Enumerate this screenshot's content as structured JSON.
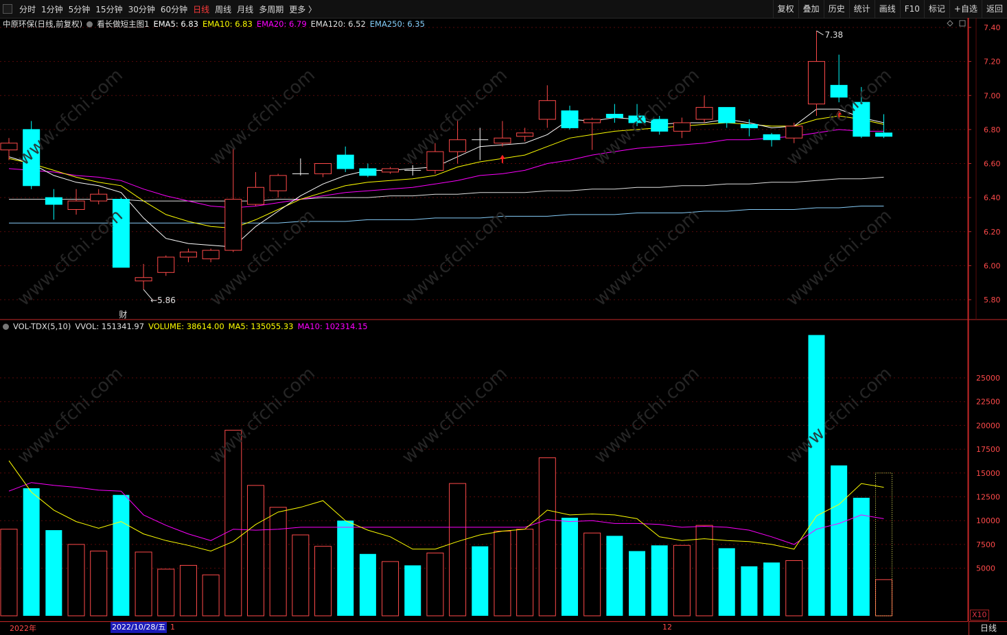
{
  "toolbar": {
    "periods": [
      "分时",
      "1分钟",
      "5分钟",
      "15分钟",
      "30分钟",
      "60分钟",
      "日线",
      "周线",
      "月线",
      "多周期",
      "更多 〉"
    ],
    "active_period": "日线",
    "right_buttons": [
      "复权",
      "叠加",
      "历史",
      "统计",
      "画线",
      "F10",
      "标记",
      "+自选",
      "返回"
    ]
  },
  "main_info": {
    "title": "中原环保(日线,前复权)",
    "indicator_name": "看长做短主图1",
    "ema5": "EMA5: 6.83",
    "ema10": "EMA10: 6.83",
    "ema20": "EMA20: 6.79",
    "ema120": "EMA120: 6.52",
    "ema250": "EMA250: 6.35"
  },
  "vol_info": {
    "name": "VOL-TDX(5,10)",
    "vvol": "VVOL: 151341.97",
    "volume": "VOLUME: 38614.00",
    "ma5": "MA5: 135055.33",
    "ma10": "MA10: 102314.15"
  },
  "price_axis": [
    "7.40",
    "7.20",
    "7.00",
    "6.80",
    "6.60",
    "6.40",
    "6.20",
    "6.00",
    "5.80"
  ],
  "vol_axis": [
    "25000",
    "22500",
    "20000",
    "17500",
    "15000",
    "12500",
    "10000",
    "7500",
    "5000"
  ],
  "annotations": {
    "high_label": "7.38",
    "low_label": "5.86",
    "fin_marker": "财"
  },
  "bottom": {
    "year_label": "2022年",
    "selected_date": "2022/10/28/五",
    "selected_suffix": "1",
    "month_label": "12",
    "corner_label": "日线",
    "x10": "X10"
  },
  "colors": {
    "up": "#ff4a4a",
    "down": "#00ffff",
    "ema5": "#ffffff",
    "ema10": "#ffff00",
    "ema20": "#ff00ff",
    "ema120": "#9370db",
    "ema250": "#87cefa",
    "bg": "#000000",
    "grid": "#5a0a0a"
  },
  "chart_data": [
    {
      "type": "candlestick",
      "title": "中原环保(日线,前复权)",
      "ylim": [
        5.7,
        7.45
      ],
      "candles": [
        {
          "o": 6.68,
          "h": 6.75,
          "l": 6.62,
          "c": 6.72
        },
        {
          "o": 6.8,
          "h": 6.85,
          "l": 6.45,
          "c": 6.47
        },
        {
          "o": 6.4,
          "h": 6.45,
          "l": 6.27,
          "c": 6.36
        },
        {
          "o": 6.33,
          "h": 6.45,
          "l": 6.3,
          "c": 6.38
        },
        {
          "o": 6.38,
          "h": 6.45,
          "l": 6.36,
          "c": 6.42
        },
        {
          "o": 6.39,
          "h": 6.4,
          "l": 5.99,
          "c": 5.99
        },
        {
          "o": 5.91,
          "h": 6.01,
          "l": 5.86,
          "c": 5.93
        },
        {
          "o": 5.96,
          "h": 6.06,
          "l": 5.94,
          "c": 6.05
        },
        {
          "o": 6.05,
          "h": 6.1,
          "l": 6.02,
          "c": 6.08
        },
        {
          "o": 6.04,
          "h": 6.1,
          "l": 6.02,
          "c": 6.09
        },
        {
          "o": 6.09,
          "h": 6.69,
          "l": 6.08,
          "c": 6.39
        },
        {
          "o": 6.36,
          "h": 6.55,
          "l": 6.35,
          "c": 6.46
        },
        {
          "o": 6.44,
          "h": 6.54,
          "l": 6.4,
          "c": 6.53
        },
        {
          "o": 6.54,
          "h": 6.63,
          "l": 6.53,
          "c": 6.54
        },
        {
          "o": 6.54,
          "h": 6.6,
          "l": 6.52,
          "c": 6.6
        },
        {
          "o": 6.65,
          "h": 6.7,
          "l": 6.55,
          "c": 6.57
        },
        {
          "o": 6.57,
          "h": 6.6,
          "l": 6.52,
          "c": 6.53
        },
        {
          "o": 6.55,
          "h": 6.58,
          "l": 6.54,
          "c": 6.57
        },
        {
          "o": 6.56,
          "h": 6.59,
          "l": 6.53,
          "c": 6.56
        },
        {
          "o": 6.56,
          "h": 6.72,
          "l": 6.54,
          "c": 6.67
        },
        {
          "o": 6.67,
          "h": 6.86,
          "l": 6.6,
          "c": 6.74
        },
        {
          "o": 6.74,
          "h": 6.81,
          "l": 6.62,
          "c": 6.74
        },
        {
          "o": 6.72,
          "h": 6.85,
          "l": 6.7,
          "c": 6.75
        },
        {
          "o": 6.76,
          "h": 6.81,
          "l": 6.73,
          "c": 6.78
        },
        {
          "o": 6.86,
          "h": 7.06,
          "l": 6.81,
          "c": 6.97
        },
        {
          "o": 6.91,
          "h": 6.94,
          "l": 6.8,
          "c": 6.81
        },
        {
          "o": 6.84,
          "h": 6.87,
          "l": 6.68,
          "c": 6.86
        },
        {
          "o": 6.89,
          "h": 6.95,
          "l": 6.84,
          "c": 6.87
        },
        {
          "o": 6.88,
          "h": 6.95,
          "l": 6.82,
          "c": 6.84
        },
        {
          "o": 6.86,
          "h": 6.88,
          "l": 6.77,
          "c": 6.79
        },
        {
          "o": 6.79,
          "h": 6.87,
          "l": 6.75,
          "c": 6.84
        },
        {
          "o": 6.86,
          "h": 7.0,
          "l": 6.84,
          "c": 6.93
        },
        {
          "o": 6.93,
          "h": 6.93,
          "l": 6.81,
          "c": 6.84
        },
        {
          "o": 6.83,
          "h": 6.86,
          "l": 6.76,
          "c": 6.81
        },
        {
          "o": 6.77,
          "h": 6.78,
          "l": 6.7,
          "c": 6.74
        },
        {
          "o": 6.75,
          "h": 6.84,
          "l": 6.72,
          "c": 6.82
        },
        {
          "o": 6.95,
          "h": 7.38,
          "l": 6.88,
          "c": 7.2
        },
        {
          "o": 7.06,
          "h": 7.24,
          "l": 6.96,
          "c": 6.99
        },
        {
          "o": 6.96,
          "h": 7.05,
          "l": 6.75,
          "c": 6.76
        },
        {
          "o": 6.78,
          "h": 6.89,
          "l": 6.75,
          "c": 6.76
        }
      ],
      "ema5": [
        6.64,
        6.6,
        6.53,
        6.49,
        6.47,
        6.43,
        6.28,
        6.16,
        6.13,
        6.12,
        6.11,
        6.23,
        6.32,
        6.41,
        6.48,
        6.53,
        6.56,
        6.56,
        6.57,
        6.58,
        6.64,
        6.7,
        6.71,
        6.72,
        6.77,
        6.86,
        6.85,
        6.87,
        6.86,
        6.83,
        6.84,
        6.84,
        6.86,
        6.84,
        6.81,
        6.82,
        6.92,
        6.92,
        6.87,
        6.84
      ],
      "ema10": [
        6.63,
        6.6,
        6.56,
        6.52,
        6.49,
        6.47,
        6.38,
        6.3,
        6.26,
        6.23,
        6.22,
        6.27,
        6.33,
        6.39,
        6.43,
        6.47,
        6.49,
        6.5,
        6.51,
        6.53,
        6.58,
        6.61,
        6.63,
        6.65,
        6.7,
        6.75,
        6.77,
        6.79,
        6.8,
        6.81,
        6.82,
        6.83,
        6.84,
        6.83,
        6.82,
        6.82,
        6.86,
        6.88,
        6.86,
        6.83
      ],
      "ema20": [
        6.57,
        6.56,
        6.55,
        6.53,
        6.52,
        6.5,
        6.45,
        6.41,
        6.38,
        6.35,
        6.34,
        6.35,
        6.37,
        6.39,
        6.41,
        6.43,
        6.44,
        6.45,
        6.46,
        6.48,
        6.5,
        6.53,
        6.54,
        6.56,
        6.6,
        6.62,
        6.65,
        6.67,
        6.69,
        6.7,
        6.71,
        6.72,
        6.74,
        6.74,
        6.75,
        6.76,
        6.78,
        6.8,
        6.79,
        6.79
      ],
      "ema120": [
        6.39,
        6.39,
        6.39,
        6.39,
        6.39,
        6.39,
        6.38,
        6.38,
        6.38,
        6.38,
        6.38,
        6.38,
        6.39,
        6.39,
        6.4,
        6.4,
        6.4,
        6.41,
        6.41,
        6.42,
        6.42,
        6.43,
        6.43,
        6.43,
        6.44,
        6.44,
        6.45,
        6.45,
        6.46,
        6.46,
        6.47,
        6.47,
        6.48,
        6.48,
        6.49,
        6.49,
        6.5,
        6.51,
        6.51,
        6.52
      ],
      "ema250": [
        6.25,
        6.25,
        6.25,
        6.25,
        6.25,
        6.25,
        6.25,
        6.25,
        6.25,
        6.25,
        6.25,
        6.25,
        6.25,
        6.26,
        6.26,
        6.26,
        6.27,
        6.27,
        6.27,
        6.28,
        6.28,
        6.28,
        6.29,
        6.29,
        6.29,
        6.3,
        6.3,
        6.3,
        6.31,
        6.31,
        6.31,
        6.32,
        6.32,
        6.33,
        6.33,
        6.33,
        6.34,
        6.34,
        6.35,
        6.35
      ]
    },
    {
      "type": "bar",
      "title": "VOL-TDX(5,10)",
      "ylim": [
        0,
        30000
      ],
      "volumes": [
        9100,
        13400,
        9000,
        7500,
        6800,
        12700,
        6700,
        4900,
        5300,
        4300,
        19500,
        13700,
        11400,
        8500,
        7300,
        10000,
        6500,
        5700,
        5300,
        6600,
        13900,
        7300,
        8900,
        9100,
        16600,
        10300,
        8700,
        8400,
        6800,
        7400,
        7400,
        9500,
        7100,
        5200,
        5600,
        5800,
        29500,
        15800,
        12400,
        3800
      ],
      "vol_color": [
        "up",
        "down",
        "down",
        "up",
        "up",
        "down",
        "up",
        "up",
        "up",
        "up",
        "up",
        "up",
        "up",
        "up",
        "up",
        "down",
        "down",
        "up",
        "down",
        "up",
        "up",
        "down",
        "up",
        "up",
        "up",
        "down",
        "up",
        "down",
        "down",
        "down",
        "up",
        "up",
        "down",
        "down",
        "down",
        "up",
        "down",
        "down",
        "down",
        "up"
      ],
      "ma5": [
        16300,
        13000,
        11100,
        9900,
        9200,
        9900,
        8600,
        7900,
        7400,
        6800,
        7800,
        9600,
        10900,
        11400,
        12100,
        10000,
        9000,
        8300,
        7000,
        7000,
        7800,
        8500,
        8900,
        9100,
        11100,
        10600,
        10700,
        10600,
        10200,
        8300,
        7900,
        8100,
        7900,
        7800,
        7500,
        7000,
        10500,
        11700,
        13900,
        13500
      ],
      "ma10": [
        13100,
        14000,
        13700,
        13500,
        13200,
        13100,
        10600,
        9500,
        8600,
        7900,
        9100,
        9000,
        9100,
        9300,
        9300,
        9300,
        9300,
        9300,
        9300,
        9300,
        9300,
        9300,
        9300,
        9300,
        10100,
        9900,
        10000,
        9700,
        9700,
        9600,
        9300,
        9400,
        9300,
        9000,
        8300,
        7500,
        9100,
        9700,
        10600,
        10200
      ],
      "big_last_outline": 15000
    }
  ]
}
